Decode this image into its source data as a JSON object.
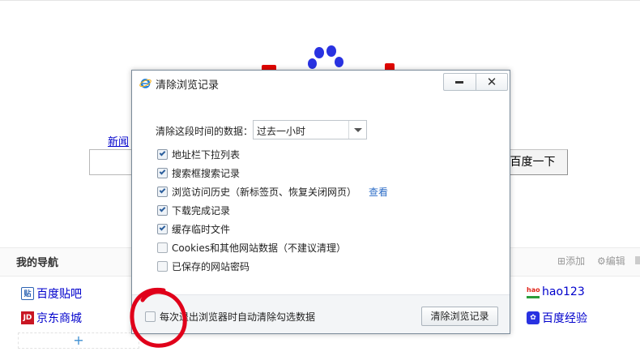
{
  "background": {
    "news_link": "新闻",
    "search_button": "百度一下",
    "nav": {
      "title": "我的导航",
      "add_label": "添加",
      "edit_label": "编辑"
    },
    "sites": [
      {
        "label": "百度贴吧",
        "icon": "tieba-icon"
      },
      {
        "label": "京东商城",
        "icon": "jd-icon",
        "icon_text": "JD"
      },
      {
        "label": "hao123",
        "icon": "hao123-icon",
        "icon_text": "hao"
      },
      {
        "label": "百度经验",
        "icon": "baidu-paw-icon"
      }
    ],
    "add_site_symbol": "+"
  },
  "dialog": {
    "title": "清除浏览记录",
    "range_label": "清除这段时间的数据：",
    "range_value": "过去一小时",
    "options": [
      {
        "label": "地址栏下拉列表",
        "checked": true
      },
      {
        "label": "搜索框搜索记录",
        "checked": true
      },
      {
        "label": "浏览访问历史（新标签页、恢复关闭网页）",
        "checked": true,
        "link": "查看"
      },
      {
        "label": "下载完成记录",
        "checked": true
      },
      {
        "label": "缓存临时文件",
        "checked": true
      },
      {
        "label": "Cookies和其他网站数据（不建议清理）",
        "checked": false
      },
      {
        "label": "已保存的网站密码",
        "checked": false
      }
    ],
    "auto_clear_label": "每次退出浏览器时自动清除勾选数据",
    "auto_clear_checked": false,
    "clear_button": "清除浏览记录"
  },
  "colors": {
    "link_blue": "#0000cc",
    "dialog_link": "#2e6ec7",
    "annotation_red": "#e0001a",
    "baidu_blue": "#2932e1",
    "baidu_red": "#e10601"
  }
}
